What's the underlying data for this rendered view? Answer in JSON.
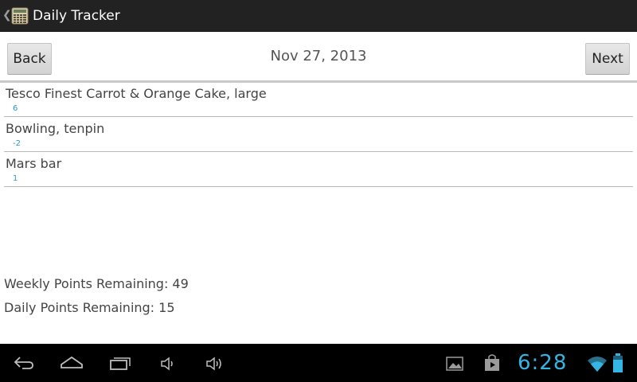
{
  "action_bar": {
    "title": "Daily Tracker",
    "icons": [
      "back-caret-icon",
      "calculator-icon"
    ]
  },
  "header": {
    "back_label": "Back",
    "next_label": "Next",
    "date": "Nov 27, 2013"
  },
  "entries": [
    {
      "name": "Tesco Finest Carrot & Orange Cake, large",
      "points": "6"
    },
    {
      "name": "Bowling, tenpin",
      "points": "-2"
    },
    {
      "name": "Mars bar",
      "points": "1"
    }
  ],
  "totals": {
    "weekly": "Weekly Points Remaining: 49",
    "daily": "Daily Points Remaining: 15"
  },
  "status_bar": {
    "time": "6:28",
    "icons": [
      "back-icon",
      "home-icon",
      "recent-apps-icon",
      "volume-down-icon",
      "volume-up-icon",
      "gallery-icon",
      "play-store-icon",
      "wifi-icon",
      "battery-icon"
    ]
  },
  "colors": {
    "accent": "#33b5e5",
    "points_text": "#2c9cc8",
    "action_bar": "#222222"
  }
}
